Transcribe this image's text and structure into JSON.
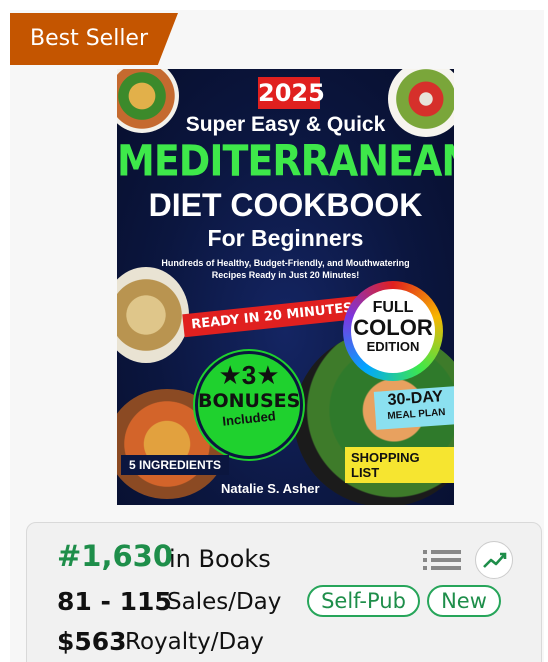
{
  "badge": {
    "label": "Best Seller",
    "color": "#c45500"
  },
  "cover": {
    "year": "2025",
    "line1": "Super Easy & Quick",
    "line2": "MEDITERRANEAN",
    "line3": "DIET COOKBOOK",
    "line4": "For Beginners",
    "subtitle": "Hundreds of Healthy, Budget-Friendly, and Mouthwatering Recipes Ready in Just 20 Minutes!",
    "ready": "READY IN 20 MINUTES",
    "full_color": [
      "FULL",
      "COLOR",
      "EDITION"
    ],
    "bonuses": [
      "★3★",
      "BONUSES",
      "Included"
    ],
    "meal_plan": [
      "30-DAY",
      "MEAL PLAN"
    ],
    "shopping": "SHOPPING LIST",
    "ingredients": "5 INGREDIENTS",
    "author": "Natalie S. Asher"
  },
  "stats": {
    "rank": "#1,630",
    "rank_category": "in Books",
    "sales_range": "81 - 115",
    "sales_label": "Sales/Day",
    "tags": [
      "Self-Pub",
      "New"
    ],
    "royalty": "$563",
    "royalty_label": "Royalty/Day",
    "accent": "#1e8e4a",
    "icons": {
      "list": "list-icon",
      "trend": "trend-chart-icon"
    }
  }
}
